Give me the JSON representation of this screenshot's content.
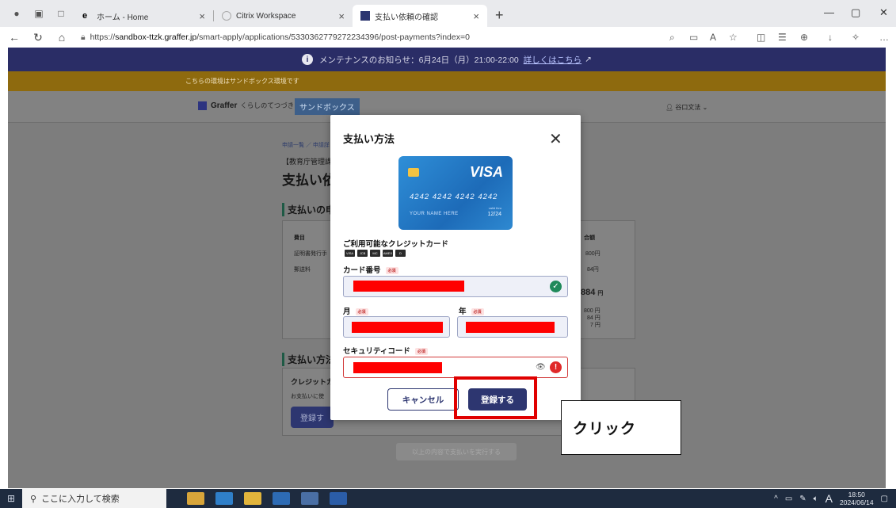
{
  "browser": {
    "tabs": [
      {
        "label": "ホーム - Home",
        "active": false
      },
      {
        "label": "Citrix Workspace",
        "active": false
      },
      {
        "label": "支払い依頼の確認",
        "active": true
      }
    ],
    "new_tab_icon": "plus-icon",
    "url_prefix": "https://",
    "url_domain": "sandbox-ttzk.graffer.jp",
    "url_path": "/smart-apply/applications/5330362779272234396/post-payments?index=0"
  },
  "page": {
    "maintenance_text": "メンテナンスのお知らせ：6月24日（月）21:00-22:00",
    "maintenance_link": "詳しくはこちら",
    "sandbox_notice": "こちらの環境はサンドボックス環境です",
    "logo_text": "Graffer",
    "logo_sub": "くらしのてつづき",
    "sandbox_button": "サンドボックス",
    "user_name": "谷口文法",
    "breadcrumb": "申請一覧 ／ 申請詳",
    "department": "【教育庁管理課",
    "title": "支払い依",
    "section_fee": "支払いの申",
    "fee_col_item": "費目",
    "fee_col_total": "合額",
    "fee_row1_name": "証明書発行手",
    "fee_row1_amount": "800円",
    "fee_row2_name": "郵送料",
    "fee_row2_amount": "84円",
    "fee_total": "884",
    "fee_total_unit": "円",
    "fee_break1": "800 円",
    "fee_break2": "84 円",
    "fee_break3": "7 円",
    "section_method": "支払い方法",
    "method_card_title": "クレジットカ",
    "method_note": "お支払いに使",
    "method_register": "登録す",
    "execute_button": "以上の内容で支払いを実行する"
  },
  "modal": {
    "title": "支払い方法",
    "close_icon": "close-icon",
    "card": {
      "brand": "VISA",
      "number": "4242 4242 4242 4242",
      "name": "YOUR NAME HERE",
      "valid_label": "valid thru",
      "expiry": "12/24"
    },
    "available_cards_label": "ご利用可能なクレジットカード",
    "brands": [
      "VISA",
      "JCB",
      "MC",
      "AMEX",
      "D"
    ],
    "card_number_label": "カード番号",
    "month_label": "月",
    "year_label": "年",
    "security_code_label": "セキュリティコード",
    "required_badge": "必須",
    "cancel_button": "キャンセル",
    "register_button": "登録する"
  },
  "annotation": {
    "callout_text": "クリック",
    "highlight_color": "#e00000"
  },
  "taskbar": {
    "search_placeholder": "ここに入力して検索",
    "time": "18:50",
    "date": "2024/06/14",
    "ime": "A"
  },
  "colors": {
    "brand_navy": "#2d3670",
    "success_green": "#1f8a5a",
    "error_red": "#e02929"
  }
}
